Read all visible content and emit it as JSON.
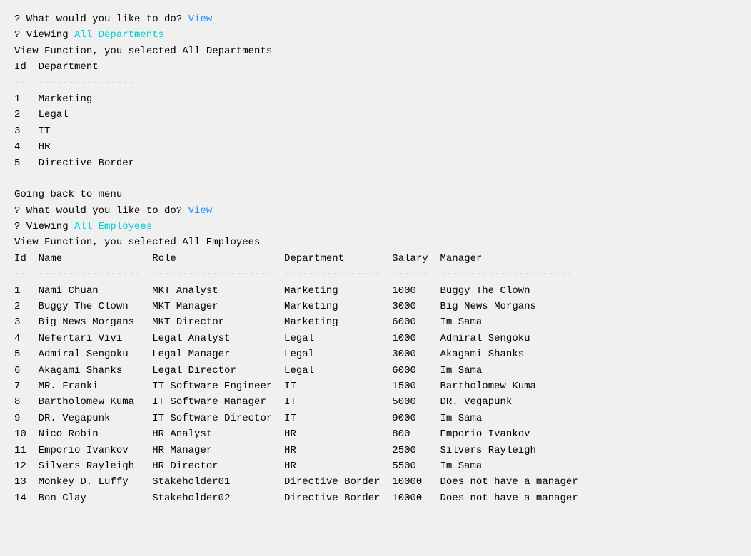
{
  "terminal": {
    "lines": [
      {
        "type": "prompt",
        "prefix": "? What would you like to do? ",
        "value": "View",
        "valueColor": "blue"
      },
      {
        "type": "prompt",
        "prefix": "? Viewing ",
        "value": "All Departments",
        "valueColor": "cyan"
      },
      {
        "type": "plain",
        "text": "View Function, you selected All Departments"
      },
      {
        "type": "header",
        "text": "Id  Department"
      },
      {
        "type": "divider",
        "text": "--  ----------------"
      },
      {
        "type": "data",
        "text": "1   Marketing"
      },
      {
        "type": "data",
        "text": "2   Legal"
      },
      {
        "type": "data",
        "text": "3   IT"
      },
      {
        "type": "data",
        "text": "4   HR"
      },
      {
        "type": "data",
        "text": "5   Directive Border"
      },
      {
        "type": "spacer"
      },
      {
        "type": "plain",
        "text": "Going back to menu"
      },
      {
        "type": "prompt",
        "prefix": "? What would you like to do? ",
        "value": "View",
        "valueColor": "blue"
      },
      {
        "type": "prompt",
        "prefix": "? Viewing ",
        "value": "All Employees",
        "valueColor": "cyan"
      },
      {
        "type": "plain",
        "text": "View Function, you selected All Employees"
      },
      {
        "type": "header",
        "text": "Id  Name               Role                  Department        Salary  Manager"
      },
      {
        "type": "divider",
        "text": "--  -----------------  --------------------  ----------------  ------  ----------------------"
      },
      {
        "type": "data",
        "text": "1   Nami Chuan         MKT Analyst           Marketing         1000    Buggy The Clown"
      },
      {
        "type": "data",
        "text": "2   Buggy The Clown    MKT Manager           Marketing         3000    Big News Morgans"
      },
      {
        "type": "data",
        "text": "3   Big News Morgans   MKT Director          Marketing         6000    Im Sama"
      },
      {
        "type": "data",
        "text": "4   Nefertari Vivi     Legal Analyst         Legal             1000    Admiral Sengoku"
      },
      {
        "type": "data",
        "text": "5   Admiral Sengoku    Legal Manager         Legal             3000    Akagami Shanks"
      },
      {
        "type": "data",
        "text": "6   Akagami Shanks     Legal Director        Legal             6000    Im Sama"
      },
      {
        "type": "data",
        "text": "7   MR. Franki         IT Software Engineer  IT                1500    Bartholomew Kuma"
      },
      {
        "type": "data",
        "text": "8   Bartholomew Kuma   IT Software Manager   IT                5000    DR. Vegapunk"
      },
      {
        "type": "data",
        "text": "9   DR. Vegapunk       IT Software Director  IT                9000    Im Sama"
      },
      {
        "type": "data",
        "text": "10  Nico Robin         HR Analyst            HR                800     Emporio Ivankov"
      },
      {
        "type": "data",
        "text": "11  Emporio Ivankov    HR Manager            HR                2500    Silvers Rayleigh"
      },
      {
        "type": "data",
        "text": "12  Silvers Rayleigh   HR Director           HR                5500    Im Sama"
      },
      {
        "type": "data",
        "text": "13  Monkey D. Luffy    Stakeholder01         Directive Border  10000   Does not have a manager"
      },
      {
        "type": "data",
        "text": "14  Bon Clay           Stakeholder02         Directive Border  10000   Does not have a manager"
      }
    ]
  }
}
